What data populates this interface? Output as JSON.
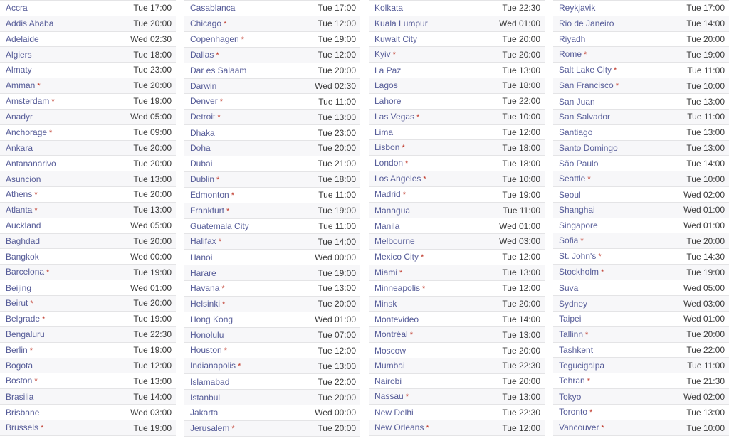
{
  "table": {
    "dst_marker": "*",
    "columns": [
      {
        "name": "column-1",
        "rows": [
          {
            "city": "Accra",
            "dst": false,
            "time": "Tue 17:00"
          },
          {
            "city": "Addis Ababa",
            "dst": false,
            "time": "Tue 20:00"
          },
          {
            "city": "Adelaide",
            "dst": false,
            "time": "Wed 02:30"
          },
          {
            "city": "Algiers",
            "dst": false,
            "time": "Tue 18:00"
          },
          {
            "city": "Almaty",
            "dst": false,
            "time": "Tue 23:00"
          },
          {
            "city": "Amman",
            "dst": true,
            "time": "Tue 20:00"
          },
          {
            "city": "Amsterdam",
            "dst": true,
            "time": "Tue 19:00"
          },
          {
            "city": "Anadyr",
            "dst": false,
            "time": "Wed 05:00"
          },
          {
            "city": "Anchorage",
            "dst": true,
            "time": "Tue 09:00"
          },
          {
            "city": "Ankara",
            "dst": false,
            "time": "Tue 20:00"
          },
          {
            "city": "Antananarivo",
            "dst": false,
            "time": "Tue 20:00"
          },
          {
            "city": "Asuncion",
            "dst": false,
            "time": "Tue 13:00"
          },
          {
            "city": "Athens",
            "dst": true,
            "time": "Tue 20:00"
          },
          {
            "city": "Atlanta",
            "dst": true,
            "time": "Tue 13:00"
          },
          {
            "city": "Auckland",
            "dst": false,
            "time": "Wed 05:00"
          },
          {
            "city": "Baghdad",
            "dst": false,
            "time": "Tue 20:00"
          },
          {
            "city": "Bangkok",
            "dst": false,
            "time": "Wed 00:00"
          },
          {
            "city": "Barcelona",
            "dst": true,
            "time": "Tue 19:00"
          },
          {
            "city": "Beijing",
            "dst": false,
            "time": "Wed 01:00"
          },
          {
            "city": "Beirut",
            "dst": true,
            "time": "Tue 20:00"
          },
          {
            "city": "Belgrade",
            "dst": true,
            "time": "Tue 19:00"
          },
          {
            "city": "Bengaluru",
            "dst": false,
            "time": "Tue 22:30"
          },
          {
            "city": "Berlin",
            "dst": true,
            "time": "Tue 19:00"
          },
          {
            "city": "Bogota",
            "dst": false,
            "time": "Tue 12:00"
          },
          {
            "city": "Boston",
            "dst": true,
            "time": "Tue 13:00"
          },
          {
            "city": "Brasilia",
            "dst": false,
            "time": "Tue 14:00"
          },
          {
            "city": "Brisbane",
            "dst": false,
            "time": "Wed 03:00"
          },
          {
            "city": "Brussels",
            "dst": true,
            "time": "Tue 19:00"
          }
        ]
      },
      {
        "name": "column-2",
        "rows": [
          {
            "city": "Casablanca",
            "dst": false,
            "time": "Tue 17:00"
          },
          {
            "city": "Chicago",
            "dst": true,
            "time": "Tue 12:00"
          },
          {
            "city": "Copenhagen",
            "dst": true,
            "time": "Tue 19:00"
          },
          {
            "city": "Dallas",
            "dst": true,
            "time": "Tue 12:00"
          },
          {
            "city": "Dar es Salaam",
            "dst": false,
            "time": "Tue 20:00"
          },
          {
            "city": "Darwin",
            "dst": false,
            "time": "Wed 02:30"
          },
          {
            "city": "Denver",
            "dst": true,
            "time": "Tue 11:00"
          },
          {
            "city": "Detroit",
            "dst": true,
            "time": "Tue 13:00"
          },
          {
            "city": "Dhaka",
            "dst": false,
            "time": "Tue 23:00"
          },
          {
            "city": "Doha",
            "dst": false,
            "time": "Tue 20:00"
          },
          {
            "city": "Dubai",
            "dst": false,
            "time": "Tue 21:00"
          },
          {
            "city": "Dublin",
            "dst": true,
            "time": "Tue 18:00"
          },
          {
            "city": "Edmonton",
            "dst": true,
            "time": "Tue 11:00"
          },
          {
            "city": "Frankfurt",
            "dst": true,
            "time": "Tue 19:00"
          },
          {
            "city": "Guatemala City",
            "dst": false,
            "time": "Tue 11:00"
          },
          {
            "city": "Halifax",
            "dst": true,
            "time": "Tue 14:00"
          },
          {
            "city": "Hanoi",
            "dst": false,
            "time": "Wed 00:00"
          },
          {
            "city": "Harare",
            "dst": false,
            "time": "Tue 19:00"
          },
          {
            "city": "Havana",
            "dst": true,
            "time": "Tue 13:00"
          },
          {
            "city": "Helsinki",
            "dst": true,
            "time": "Tue 20:00"
          },
          {
            "city": "Hong Kong",
            "dst": false,
            "time": "Wed 01:00"
          },
          {
            "city": "Honolulu",
            "dst": false,
            "time": "Tue 07:00"
          },
          {
            "city": "Houston",
            "dst": true,
            "time": "Tue 12:00"
          },
          {
            "city": "Indianapolis",
            "dst": true,
            "time": "Tue 13:00"
          },
          {
            "city": "Islamabad",
            "dst": false,
            "time": "Tue 22:00"
          },
          {
            "city": "Istanbul",
            "dst": false,
            "time": "Tue 20:00"
          },
          {
            "city": "Jakarta",
            "dst": false,
            "time": "Wed 00:00"
          },
          {
            "city": "Jerusalem",
            "dst": true,
            "time": "Tue 20:00"
          }
        ]
      },
      {
        "name": "column-3",
        "rows": [
          {
            "city": "Kolkata",
            "dst": false,
            "time": "Tue 22:30"
          },
          {
            "city": "Kuala Lumpur",
            "dst": false,
            "time": "Wed 01:00"
          },
          {
            "city": "Kuwait City",
            "dst": false,
            "time": "Tue 20:00"
          },
          {
            "city": "Kyiv",
            "dst": true,
            "time": "Tue 20:00"
          },
          {
            "city": "La Paz",
            "dst": false,
            "time": "Tue 13:00"
          },
          {
            "city": "Lagos",
            "dst": false,
            "time": "Tue 18:00"
          },
          {
            "city": "Lahore",
            "dst": false,
            "time": "Tue 22:00"
          },
          {
            "city": "Las Vegas",
            "dst": true,
            "time": "Tue 10:00"
          },
          {
            "city": "Lima",
            "dst": false,
            "time": "Tue 12:00"
          },
          {
            "city": "Lisbon",
            "dst": true,
            "time": "Tue 18:00"
          },
          {
            "city": "London",
            "dst": true,
            "time": "Tue 18:00"
          },
          {
            "city": "Los Angeles",
            "dst": true,
            "time": "Tue 10:00"
          },
          {
            "city": "Madrid",
            "dst": true,
            "time": "Tue 19:00"
          },
          {
            "city": "Managua",
            "dst": false,
            "time": "Tue 11:00"
          },
          {
            "city": "Manila",
            "dst": false,
            "time": "Wed 01:00"
          },
          {
            "city": "Melbourne",
            "dst": false,
            "time": "Wed 03:00"
          },
          {
            "city": "Mexico City",
            "dst": true,
            "time": "Tue 12:00"
          },
          {
            "city": "Miami",
            "dst": true,
            "time": "Tue 13:00"
          },
          {
            "city": "Minneapolis",
            "dst": true,
            "time": "Tue 12:00"
          },
          {
            "city": "Minsk",
            "dst": false,
            "time": "Tue 20:00"
          },
          {
            "city": "Montevideo",
            "dst": false,
            "time": "Tue 14:00"
          },
          {
            "city": "Montréal",
            "dst": true,
            "time": "Tue 13:00"
          },
          {
            "city": "Moscow",
            "dst": false,
            "time": "Tue 20:00"
          },
          {
            "city": "Mumbai",
            "dst": false,
            "time": "Tue 22:30"
          },
          {
            "city": "Nairobi",
            "dst": false,
            "time": "Tue 20:00"
          },
          {
            "city": "Nassau",
            "dst": true,
            "time": "Tue 13:00"
          },
          {
            "city": "New Delhi",
            "dst": false,
            "time": "Tue 22:30"
          },
          {
            "city": "New Orleans",
            "dst": true,
            "time": "Tue 12:00"
          }
        ]
      },
      {
        "name": "column-4",
        "rows": [
          {
            "city": "Reykjavik",
            "dst": false,
            "time": "Tue 17:00"
          },
          {
            "city": "Rio de Janeiro",
            "dst": false,
            "time": "Tue 14:00"
          },
          {
            "city": "Riyadh",
            "dst": false,
            "time": "Tue 20:00"
          },
          {
            "city": "Rome",
            "dst": true,
            "time": "Tue 19:00"
          },
          {
            "city": "Salt Lake City",
            "dst": true,
            "time": "Tue 11:00"
          },
          {
            "city": "San Francisco",
            "dst": true,
            "time": "Tue 10:00"
          },
          {
            "city": "San Juan",
            "dst": false,
            "time": "Tue 13:00"
          },
          {
            "city": "San Salvador",
            "dst": false,
            "time": "Tue 11:00"
          },
          {
            "city": "Santiago",
            "dst": false,
            "time": "Tue 13:00"
          },
          {
            "city": "Santo Domingo",
            "dst": false,
            "time": "Tue 13:00"
          },
          {
            "city": "São Paulo",
            "dst": false,
            "time": "Tue 14:00"
          },
          {
            "city": "Seattle",
            "dst": true,
            "time": "Tue 10:00"
          },
          {
            "city": "Seoul",
            "dst": false,
            "time": "Wed 02:00"
          },
          {
            "city": "Shanghai",
            "dst": false,
            "time": "Wed 01:00"
          },
          {
            "city": "Singapore",
            "dst": false,
            "time": "Wed 01:00"
          },
          {
            "city": "Sofia",
            "dst": true,
            "time": "Tue 20:00"
          },
          {
            "city": "St. John's",
            "dst": true,
            "time": "Tue 14:30"
          },
          {
            "city": "Stockholm",
            "dst": true,
            "time": "Tue 19:00"
          },
          {
            "city": "Suva",
            "dst": false,
            "time": "Wed 05:00"
          },
          {
            "city": "Sydney",
            "dst": false,
            "time": "Wed 03:00"
          },
          {
            "city": "Taipei",
            "dst": false,
            "time": "Wed 01:00"
          },
          {
            "city": "Tallinn",
            "dst": true,
            "time": "Tue 20:00"
          },
          {
            "city": "Tashkent",
            "dst": false,
            "time": "Tue 22:00"
          },
          {
            "city": "Tegucigalpa",
            "dst": false,
            "time": "Tue 11:00"
          },
          {
            "city": "Tehran",
            "dst": true,
            "time": "Tue 21:30"
          },
          {
            "city": "Tokyo",
            "dst": false,
            "time": "Wed 02:00"
          },
          {
            "city": "Toronto",
            "dst": true,
            "time": "Tue 13:00"
          },
          {
            "city": "Vancouver",
            "dst": true,
            "time": "Tue 10:00"
          }
        ]
      }
    ]
  },
  "colors": {
    "city_link": "#565c98",
    "time_text": "#3b3b3b",
    "dst_marker": "#c0392b",
    "row_stripe": "#f7f7f9",
    "row_base": "#ffffff",
    "row_border": "#e4e4e6"
  }
}
